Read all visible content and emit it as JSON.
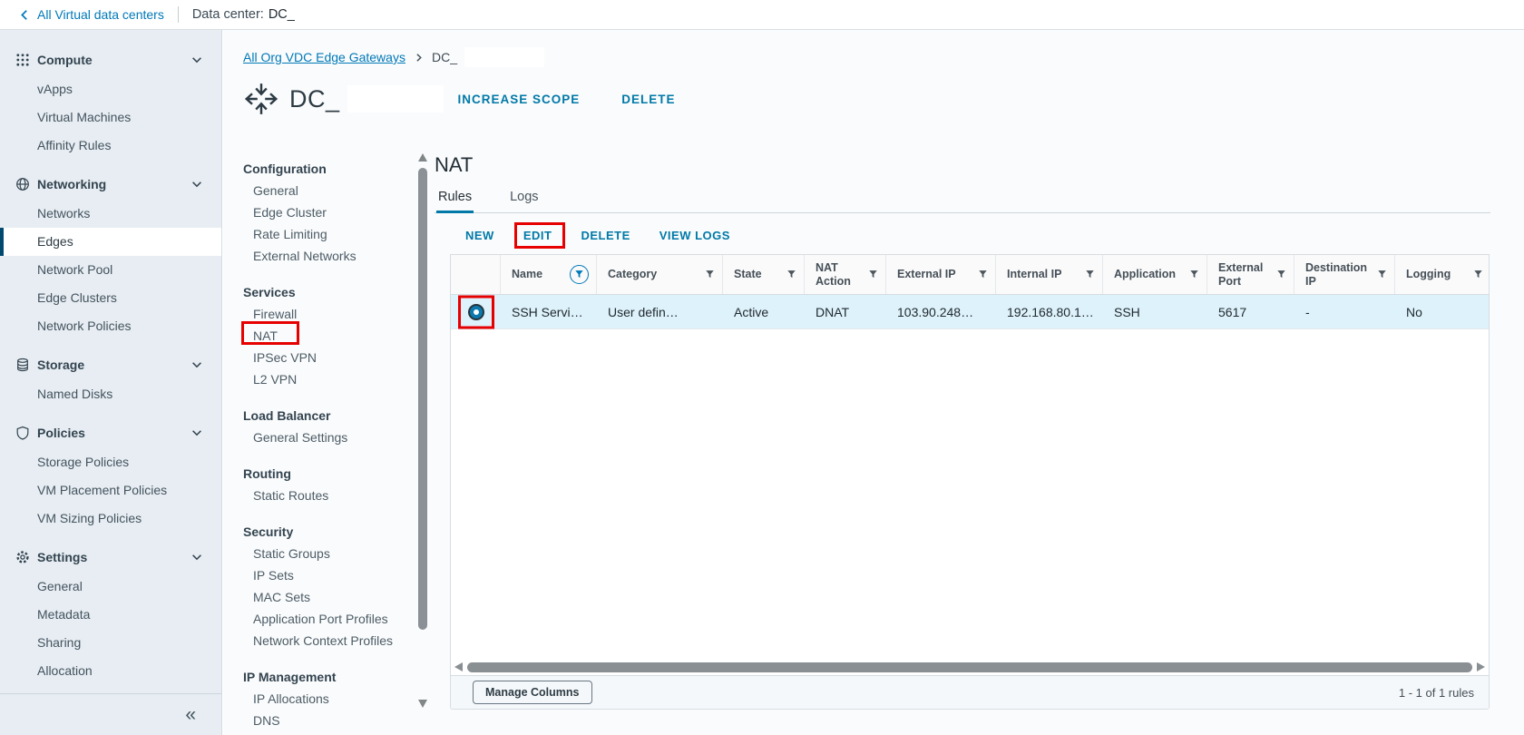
{
  "topbar": {
    "back_label": "All Virtual data centers",
    "context_label": "Data center:",
    "context_value": "DC_"
  },
  "sidebar": {
    "sections": [
      {
        "label": "Compute",
        "icon": "grid-dots-icon",
        "items": [
          "vApps",
          "Virtual Machines",
          "Affinity Rules"
        ]
      },
      {
        "label": "Networking",
        "icon": "globe-icon",
        "items": [
          "Networks",
          "Edges",
          "Network Pool",
          "Edge Clusters",
          "Network Policies"
        ],
        "selected_item": "Edges"
      },
      {
        "label": "Storage",
        "icon": "storage-disks-icon",
        "items": [
          "Named Disks"
        ]
      },
      {
        "label": "Policies",
        "icon": "shield-icon",
        "items": [
          "Storage Policies",
          "VM Placement Policies",
          "VM Sizing Policies"
        ]
      },
      {
        "label": "Settings",
        "icon": "gear-icon",
        "items": [
          "General",
          "Metadata",
          "Sharing",
          "Allocation"
        ]
      }
    ],
    "collapse_icon": "«"
  },
  "breadcrumb": {
    "link": "All Org VDC Edge Gateways",
    "current": "DC_"
  },
  "header": {
    "title": "DC_",
    "actions": [
      "INCREASE SCOPE",
      "DELETE"
    ]
  },
  "subnav": {
    "groups": [
      {
        "label": "Configuration",
        "items": [
          "General",
          "Edge Cluster",
          "Rate Limiting",
          "External Networks"
        ]
      },
      {
        "label": "Services",
        "items": [
          "Firewall",
          "NAT",
          "IPSec VPN",
          "L2 VPN"
        ],
        "highlighted_item": "NAT"
      },
      {
        "label": "Load Balancer",
        "items": [
          "General Settings"
        ]
      },
      {
        "label": "Routing",
        "items": [
          "Static Routes"
        ]
      },
      {
        "label": "Security",
        "items": [
          "Static Groups",
          "IP Sets",
          "MAC Sets",
          "Application Port Profiles",
          "Network Context Profiles"
        ]
      },
      {
        "label": "IP Management",
        "items": [
          "IP Allocations",
          "DNS"
        ]
      }
    ]
  },
  "content": {
    "title": "NAT",
    "tabs": [
      {
        "label": "Rules",
        "active": true
      },
      {
        "label": "Logs",
        "active": false
      }
    ],
    "actions": [
      "NEW",
      "EDIT",
      "DELETE",
      "VIEW LOGS"
    ],
    "highlighted_action": "EDIT",
    "table": {
      "columns": [
        "Name",
        "Category",
        "State",
        "NAT Action",
        "External IP",
        "Internal IP",
        "Application",
        "External Port",
        "Destination IP",
        "Logging"
      ],
      "name_filter_applied": true,
      "rows": [
        {
          "name": "SSH Servi…",
          "category": "User defin…",
          "state": "Active",
          "nat_action": "DNAT",
          "external_ip": "103.90.248…",
          "internal_ip": "192.168.80.1…",
          "application": "SSH",
          "external_port": "5617",
          "destination_ip": "-",
          "logging": "No",
          "selected": true
        }
      ],
      "footer": {
        "manage_columns_label": "Manage Columns",
        "count_text": "1 - 1 of 1 rules"
      }
    }
  },
  "icons": {
    "back": "chevron-left-icon",
    "section_caret": "chevron-down-icon",
    "breadcrumb_separator": "chevron-right-icon",
    "gateway_title": "edge-gateway-arrows-icon",
    "column_filter": "funnel-icon",
    "column_filter_applied": "funnel-circled-icon",
    "sidebar_collapse": "double-chevron-left-icon"
  },
  "colors": {
    "link_blue": "#0079b8",
    "action_blue": "#0079a8",
    "selected_nav_bar": "#004a70",
    "selected_row_bg": "#def2fb",
    "annotation_red": "#e60000",
    "sidebar_bg": "#e7edf2"
  }
}
